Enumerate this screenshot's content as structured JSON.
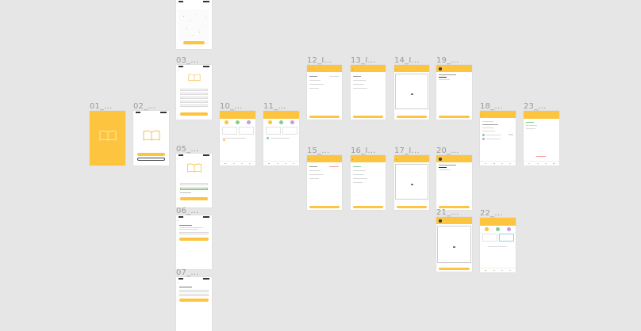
{
  "canvas": {
    "background": "#e6e6e6"
  },
  "colors": {
    "accent": "#fcc43f",
    "accent_dark": "#f0b52a",
    "green": "#7fcf8f",
    "purple": "#c59be8"
  },
  "frames": {
    "f01": {
      "label": "01_..."
    },
    "f02": {
      "label": "02_..."
    },
    "f03": {
      "label": "03_..."
    },
    "f05": {
      "label": "05_..."
    },
    "f06": {
      "label": "06_..."
    },
    "f07": {
      "label": "07_..."
    },
    "f10": {
      "label": "10_..."
    },
    "f11": {
      "label": "11_..."
    },
    "f12": {
      "label": "12_I..."
    },
    "f13": {
      "label": "13_I..."
    },
    "f14": {
      "label": "14_I..."
    },
    "f15": {
      "label": "15_..."
    },
    "f16": {
      "label": "16_I..."
    },
    "f17": {
      "label": "17_I..."
    },
    "f18": {
      "label": "18_..."
    },
    "f19": {
      "label": "19_..."
    },
    "f20": {
      "label": "20_..."
    },
    "f21": {
      "label": "21_..."
    },
    "f22": {
      "label": "22_..."
    },
    "f23": {
      "label": "23_..."
    }
  }
}
